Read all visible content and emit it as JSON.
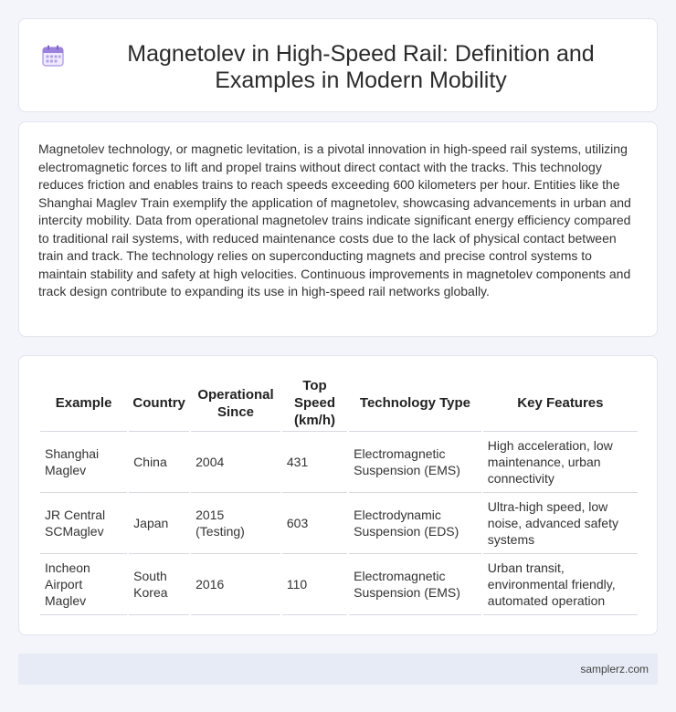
{
  "header": {
    "icon": "calendar-icon",
    "title": "Magnetolev in High-Speed Rail: Definition and Examples in Modern Mobility"
  },
  "intro": {
    "text": "Magnetolev technology, or magnetic levitation, is a pivotal innovation in high-speed rail systems, utilizing electromagnetic forces to lift and propel trains without direct contact with the tracks. This technology reduces friction and enables trains to reach speeds exceeding 600 kilometers per hour. Entities like the Shanghai Maglev Train exemplify the application of magnetolev, showcasing advancements in urban and intercity mobility. Data from operational magnetolev trains indicate significant energy efficiency compared to traditional rail systems, with reduced maintenance costs due to the lack of physical contact between train and track. The technology relies on superconducting magnets and precise control systems to maintain stability and safety at high velocities. Continuous improvements in magnetolev components and track design contribute to expanding its use in high-speed rail networks globally."
  },
  "table": {
    "headers": [
      "Example",
      "Country",
      "Operational Since",
      "Top Speed (km/h)",
      "Technology Type",
      "Key Features"
    ],
    "rows": [
      [
        "Shanghai Maglev",
        "China",
        "2004",
        "431",
        "Electromagnetic Suspension (EMS)",
        "High acceleration, low maintenance, urban connectivity"
      ],
      [
        "JR Central SCMaglev",
        "Japan",
        "2015 (Testing)",
        "603",
        "Electrodynamic Suspension (EDS)",
        "Ultra-high speed, low noise, advanced safety systems"
      ],
      [
        "Incheon Airport Maglev",
        "South Korea",
        "2016",
        "110",
        "Electromagnetic Suspension (EMS)",
        "Urban transit, environmental friendly, automated operation"
      ]
    ]
  },
  "footer": {
    "site": "samplerz.com"
  },
  "colors": {
    "background": "#f3f5fa",
    "icon_accent": "#8f73d6",
    "footer_bg": "#e6ebf5"
  }
}
